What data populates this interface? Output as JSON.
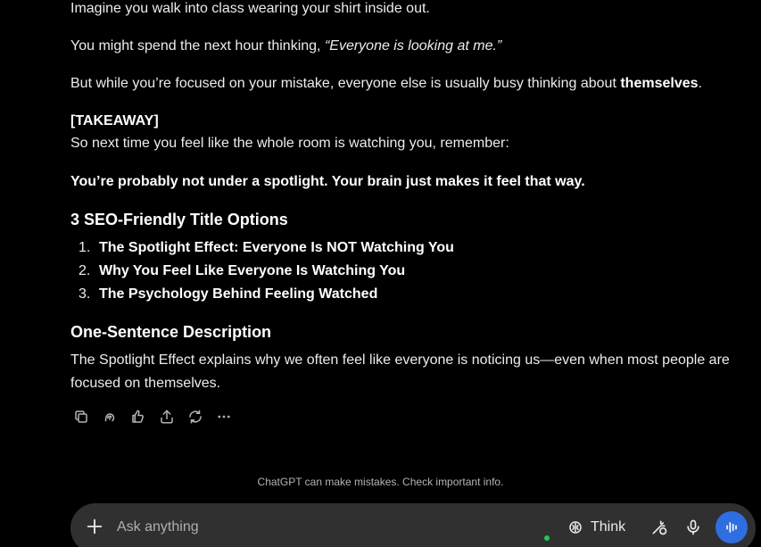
{
  "message": {
    "p1": "Imagine you walk into class wearing your shirt inside out.",
    "p2_pre": "You might spend the next hour thinking, ",
    "p2_quote": "“Everyone is looking at me.”",
    "p3_pre": "But while you’re focused on your mistake, everyone else is usually busy thinking about ",
    "p3_bold": "themselves",
    "p3_post": ".",
    "takeaway_label": "[TAKEAWAY]",
    "takeaway_text": "So next time you feel like the whole room is watching you, remember:",
    "takeaway_bold": "You’re probably not under a spotlight. Your brain just makes it feel that way.",
    "titles_heading": "3 SEO-Friendly Title Options",
    "titles": [
      {
        "num": "1.",
        "text": "The Spotlight Effect: Everyone Is NOT Watching You"
      },
      {
        "num": "2.",
        "text": "Why You Feel Like Everyone Is Watching You"
      },
      {
        "num": "3.",
        "text": "The Psychology Behind Feeling Watched"
      }
    ],
    "desc_heading": "One-Sentence Description",
    "desc_text": "The Spotlight Effect explains why we often feel like everyone is noticing us—even when most people are focused on themselves."
  },
  "actions": {
    "icons": [
      "copy-icon",
      "speaker-icon",
      "feedback-icon",
      "share-icon",
      "regenerate-icon",
      "more-icon"
    ]
  },
  "disclaimer": "ChatGPT can make mistakes. Check important info.",
  "composer": {
    "placeholder": "Ask anything",
    "think_label": "Think",
    "accent_color": "#2f6ee0",
    "status_color": "#22c55e"
  }
}
